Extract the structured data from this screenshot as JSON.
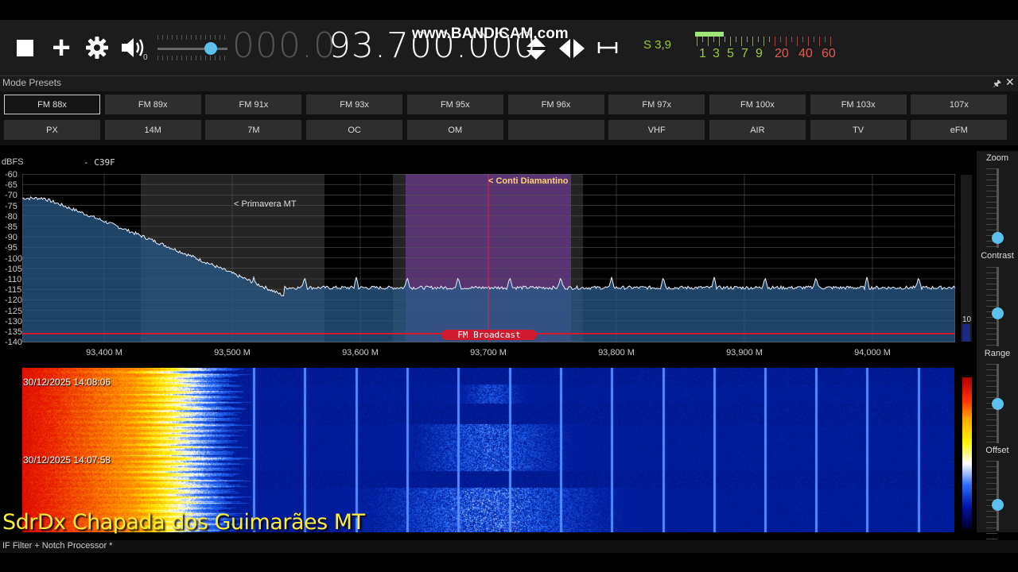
{
  "toolbar": {
    "stop_icon": "stop-square",
    "add_icon": "plus",
    "settings_icon": "gear",
    "volume_icon": "speaker",
    "volume_value": "0",
    "volume_level": 0.72,
    "freq_dim": "000.0",
    "freq_main": "93.700.000",
    "watermark": "www.BANDICAM.com",
    "smeter_label": "S 3,9",
    "smeter_scale_green": [
      "1",
      "3",
      "5",
      "7",
      "9"
    ],
    "smeter_scale_red": [
      "20",
      "40",
      "60"
    ]
  },
  "presets": {
    "title": "Mode Presets",
    "row1": [
      "FM 88x",
      "FM 89x",
      "FM 91x",
      "FM 93x",
      "FM 95x",
      "FM 96x",
      "FM 97x",
      "FM 100x",
      "FM 103x",
      "107x"
    ],
    "row2": [
      "PX",
      "14M",
      "7M",
      "OC",
      "OM",
      "",
      "VHF",
      "AIR",
      "TV",
      "eFM"
    ],
    "selected": "FM 88x"
  },
  "spectrum": {
    "unit_label": "dBFS",
    "tag": "- C39F",
    "y_ticks": [
      "-60",
      "-65",
      "-70",
      "-75",
      "-80",
      "-85",
      "-90",
      "-95",
      "-100",
      "-105",
      "-110",
      "-115",
      "-120",
      "-125",
      "-130",
      "-135",
      "-140"
    ],
    "x_ticks": [
      "93,400 M",
      "93,500 M",
      "93,600 M",
      "93,700 M",
      "93,800 M",
      "93,900 M",
      "94,000 M"
    ],
    "band_label": "FM Broadcast",
    "marker1": "< Primavera MT",
    "marker2": "< Conti Diamantino",
    "scroll_value": "10"
  },
  "waterfall": {
    "timestamp1": "30/12/2025 14:08:06",
    "timestamp2": "30/12/2025 14:07:58"
  },
  "right_panel": {
    "zoom": "Zoom",
    "contrast": "Contrast",
    "range": "Range",
    "offset": "Offset"
  },
  "overlay_title": "SdrDx Chapada dos Guimarães MT",
  "status": "IF Filter + Notch Processor *",
  "colors": {
    "accent": "#5bc0eb",
    "band": "#d11a2e",
    "smeter_green": "#9acd32",
    "smeter_red": "#e05a5a"
  }
}
